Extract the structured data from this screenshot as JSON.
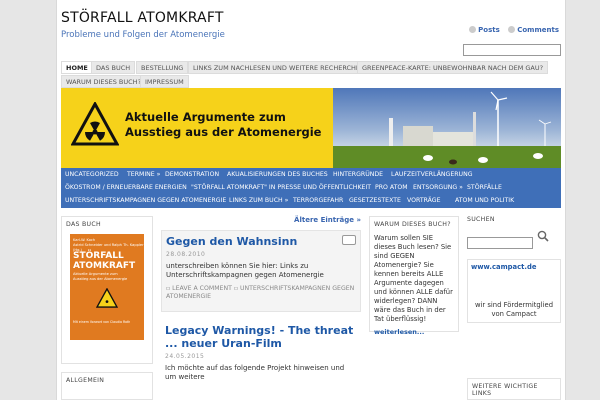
{
  "site": {
    "title": "STÖRFALL ATOMKRAFT",
    "tagline": "Probleme und Folgen der Atomenergie",
    "posts_label": "Posts",
    "comments_label": "Comments"
  },
  "nav": {
    "row1": [
      "HOME",
      "DAS BUCH",
      "BESTELLUNG",
      "LINKS ZUM NACHLESEN UND WEITERE RECHERCHEN",
      "GREENPEACE-KARTE: UNBEWOHNBAR NACH DEM GAU?"
    ],
    "row2": [
      "WARUM DIESES BUCH?",
      "IMPRESSUM"
    ]
  },
  "banner": {
    "headline_line1": "Aktuelle Argumente zum",
    "headline_line2": "Ausstieg aus der Atomenergie"
  },
  "categories": {
    "row1": [
      "UNCATEGORIZED",
      "TERMINE »",
      "DEMONSTRATION",
      "AKUALISIERUNGEN DES BUCHES",
      "HINTERGRÜNDE",
      "LAUFZEITVERLÄNGERUNG"
    ],
    "row2": [
      "ÖKOSTROM / ERNEUERBARE ENERGIEN",
      "\"STÖRFALL ATOMKRAFT\" IN PRESSE UND ÖFFENTLICHKEIT",
      "PRO ATOM",
      "ENTSORGUNG »",
      "STÖRFÄLLE"
    ],
    "row3": [
      "UNTERSCHRIFTSKAMPAGNEN GEGEN ATOMENERGIE",
      "LINKS ZUM BUCH »",
      "TERRORGEFAHR",
      "GESETZESTEXTE",
      "VORTRÄGE",
      "ATOM UND POLITIK"
    ]
  },
  "sidebar_left": {
    "book_title": "DAS BUCH",
    "book_authors_1": "Karl-W. Koch",
    "book_authors_2": "Astrid Schneider und Ralph Th. Kappler (Hg.)",
    "book_cover_title_1": "STÖRFALL",
    "book_cover_title_2": "ATOMKRAFT",
    "book_cover_sub_1": "Aktuelle Argumente zum",
    "book_cover_sub_2": "Ausstieg aus der Atomenergie",
    "book_publisher": "Mit einem Vorwort von Claudia Roth",
    "allgemein_title": "ALLGEMEIN"
  },
  "content": {
    "older_entries": "Ältere Einträge »",
    "post1": {
      "title": "Gegen den Wahnsinn",
      "date": "28.08.2010",
      "body": "unterschreiben können Sie hier:  Links zu Unterschriftskampagnen gegen Atomenergie",
      "leave_comment": "LEAVE A COMMENT",
      "category": "UNTERSCHRIFTSKAMPAGNEN GEGEN ATOMENERGIE"
    },
    "post2": {
      "title": "Legacy Warnings! - The threat ... neuer Uran-Film",
      "date": "24.05.2015",
      "body": "Ich möchte auf das folgende Projekt hinweisen und um weitere"
    }
  },
  "sidebar_middle": {
    "title": "WARUM DIESES BUCH?",
    "text": "Warum sollen SIE dieses Buch lesen? Sie sind GEGEN Atomenergie? Sie kennen bereits ALLE Argumente dagegen und können ALLE dafür widerlegen? DANN wäre das Buch in der Tat überflüssig!",
    "more": "weiterlesen..."
  },
  "sidebar_right": {
    "search_title": "SUCHEN",
    "campact_link": "www.campact.de",
    "campact_note": "wir sind Fördermitglied von Campact",
    "more_links_title": "WEITERE WICHTIGE LINKS"
  },
  "colors": {
    "accent_blue": "#3f6fb8",
    "link_blue": "#1e58a6",
    "banner_yellow": "#f6d21a",
    "book_orange": "#e07a20"
  }
}
